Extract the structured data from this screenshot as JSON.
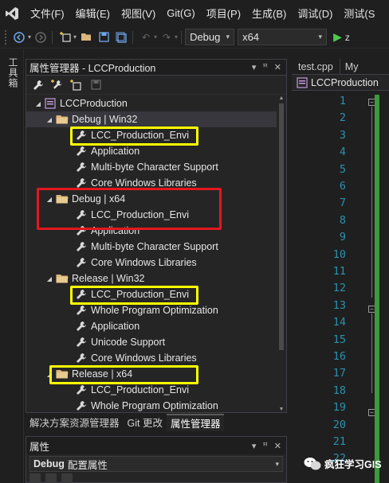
{
  "menubar": {
    "items": [
      "文件(F)",
      "编辑(E)",
      "视图(V)",
      "Git(G)",
      "项目(P)",
      "生成(B)",
      "调试(D)",
      "测试(S"
    ]
  },
  "toolbar": {
    "config_combo": "Debug",
    "platform_combo": "x64",
    "run_label": "z"
  },
  "toolbox": {
    "label": "工具箱"
  },
  "property_manager": {
    "title": "属性管理器 - LCCProduction",
    "tree": {
      "project": "LCCProduction",
      "debug_win32": {
        "label": "Debug | Win32",
        "items": [
          "LCC_Production_Envi",
          "Application",
          "Multi-byte Character Support",
          "Core Windows Libraries"
        ]
      },
      "debug_x64": {
        "label": "Debug | x64",
        "items": [
          "LCC_Production_Envi",
          "Application",
          "Multi-byte Character Support",
          "Core Windows Libraries"
        ]
      },
      "release_win32": {
        "label": "Release | Win32",
        "items": [
          "LCC_Production_Envi",
          "Whole Program Optimization",
          "Application",
          "Unicode Support",
          "Core Windows Libraries"
        ]
      },
      "release_x64": {
        "label": "Release | x64",
        "items": [
          "LCC_Production_Envi",
          "Whole Program Optimization"
        ]
      }
    }
  },
  "panel_tabs": [
    "解决方案资源管理器",
    "Git 更改",
    "属性管理器"
  ],
  "properties": {
    "title": "属性",
    "config_bold": "Debug",
    "config_rest": "配置属性"
  },
  "editor": {
    "tabs": [
      "test.cpp",
      "My"
    ],
    "nav_project": "LCCProduction",
    "line_numbers": [
      "1",
      "2",
      "3",
      "4",
      "5",
      "6",
      "7",
      "8",
      "9",
      "10",
      "11",
      "12",
      "13",
      "14",
      "15",
      "16",
      "17",
      "18",
      "19",
      "20",
      "21",
      "22"
    ]
  },
  "watermark": {
    "text": "疯狂学习GIS"
  },
  "colors": {
    "highlight_yellow": "#ffff00",
    "highlight_red": "#e3171e",
    "line_number": "#2b91af",
    "change_bar": "#3b9b3b"
  }
}
